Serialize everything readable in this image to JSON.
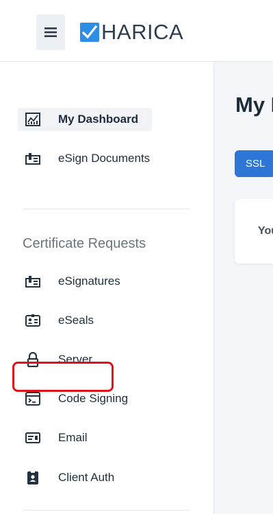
{
  "header": {
    "brand_name": "HARICA",
    "brand_color": "#2d8ee6"
  },
  "sidebar": {
    "items_top": [
      {
        "label": "My Dashboard",
        "icon": "dashboard-chart-icon",
        "active": true
      },
      {
        "label": "eSign Documents",
        "icon": "esign-document-icon",
        "active": false
      }
    ],
    "section_title": "Certificate Requests",
    "items_requests": [
      {
        "label": "eSignatures",
        "icon": "esignature-icon"
      },
      {
        "label": "eSeals",
        "icon": "eseal-badge-icon"
      },
      {
        "label": "Server",
        "icon": "lock-icon"
      },
      {
        "label": "Code Signing",
        "icon": "terminal-window-icon"
      },
      {
        "label": "Email",
        "icon": "email-card-icon",
        "highlighted": true
      },
      {
        "label": "Client Auth",
        "icon": "id-badge-icon"
      }
    ]
  },
  "main": {
    "title": "My D",
    "tab_ssl": "SSL",
    "card_text": "You"
  },
  "colors": {
    "accent": "#2f77d6",
    "highlight": "#e0121b"
  }
}
